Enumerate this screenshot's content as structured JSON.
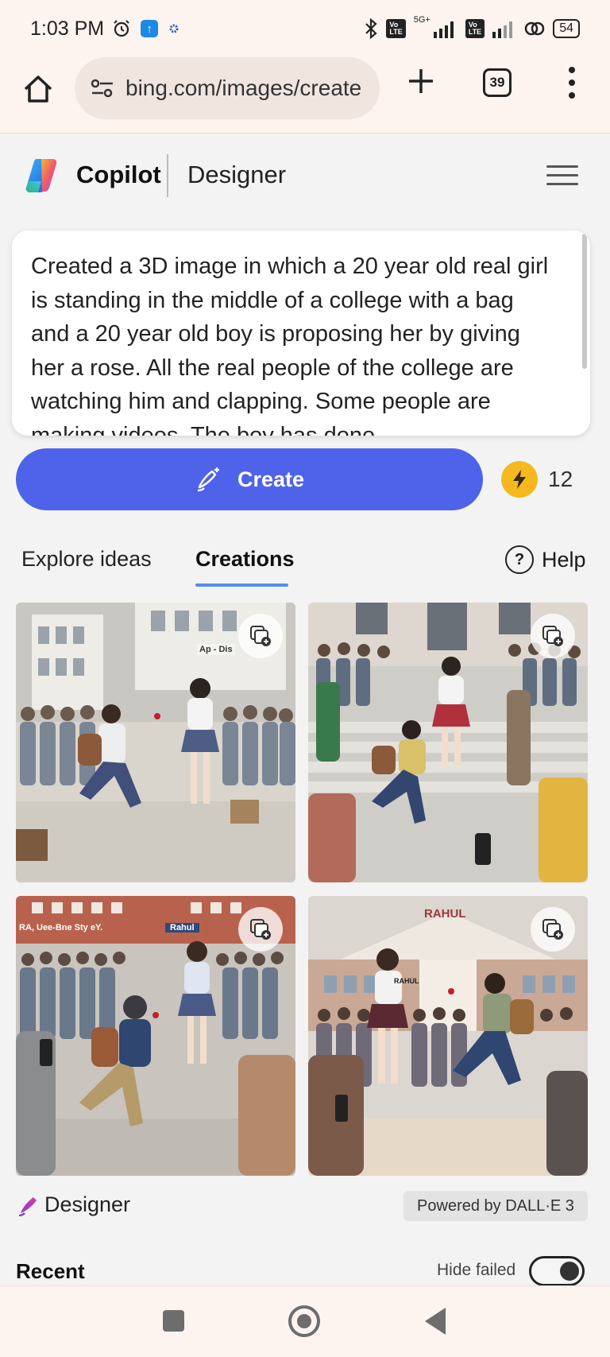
{
  "status_bar": {
    "time": "1:03 PM",
    "network_label": "5G+",
    "battery": "54"
  },
  "browser": {
    "url": "bing.com/images/create",
    "tab_count": "39"
  },
  "header": {
    "brand": "Copilot",
    "product": "Designer"
  },
  "prompt": {
    "text": "Created a 3D image in which a 20 year old real girl is standing in the middle of a college with a bag and a 20 year old boy is proposing her by giving her a rose. All the real people of the college are watching him and clapping. Some people are making videos. The boy has done"
  },
  "create": {
    "label": "Create",
    "boost_count": "12"
  },
  "tabs": {
    "explore": "Explore ideas",
    "creations": "Creations",
    "help": "Help"
  },
  "images": [
    {
      "sign": "Ap - Dis",
      "note": ""
    },
    {
      "sign": "",
      "note": ""
    },
    {
      "sign": "RA, Uee-Bne Sty eY.",
      "note": "Rahul"
    },
    {
      "sign": "RAHUL",
      "note": "RAHUL"
    }
  ],
  "footer": {
    "designer_label": "Designer",
    "powered_by": "Powered by DALL·E 3",
    "recent": "Recent",
    "hide_failed": "Hide failed"
  },
  "colors": {
    "create_button": "#4e63ea",
    "boost": "#f5b91f",
    "tab_underline": "#4e8ef0",
    "chrome_bg": "#fdf3ef"
  }
}
